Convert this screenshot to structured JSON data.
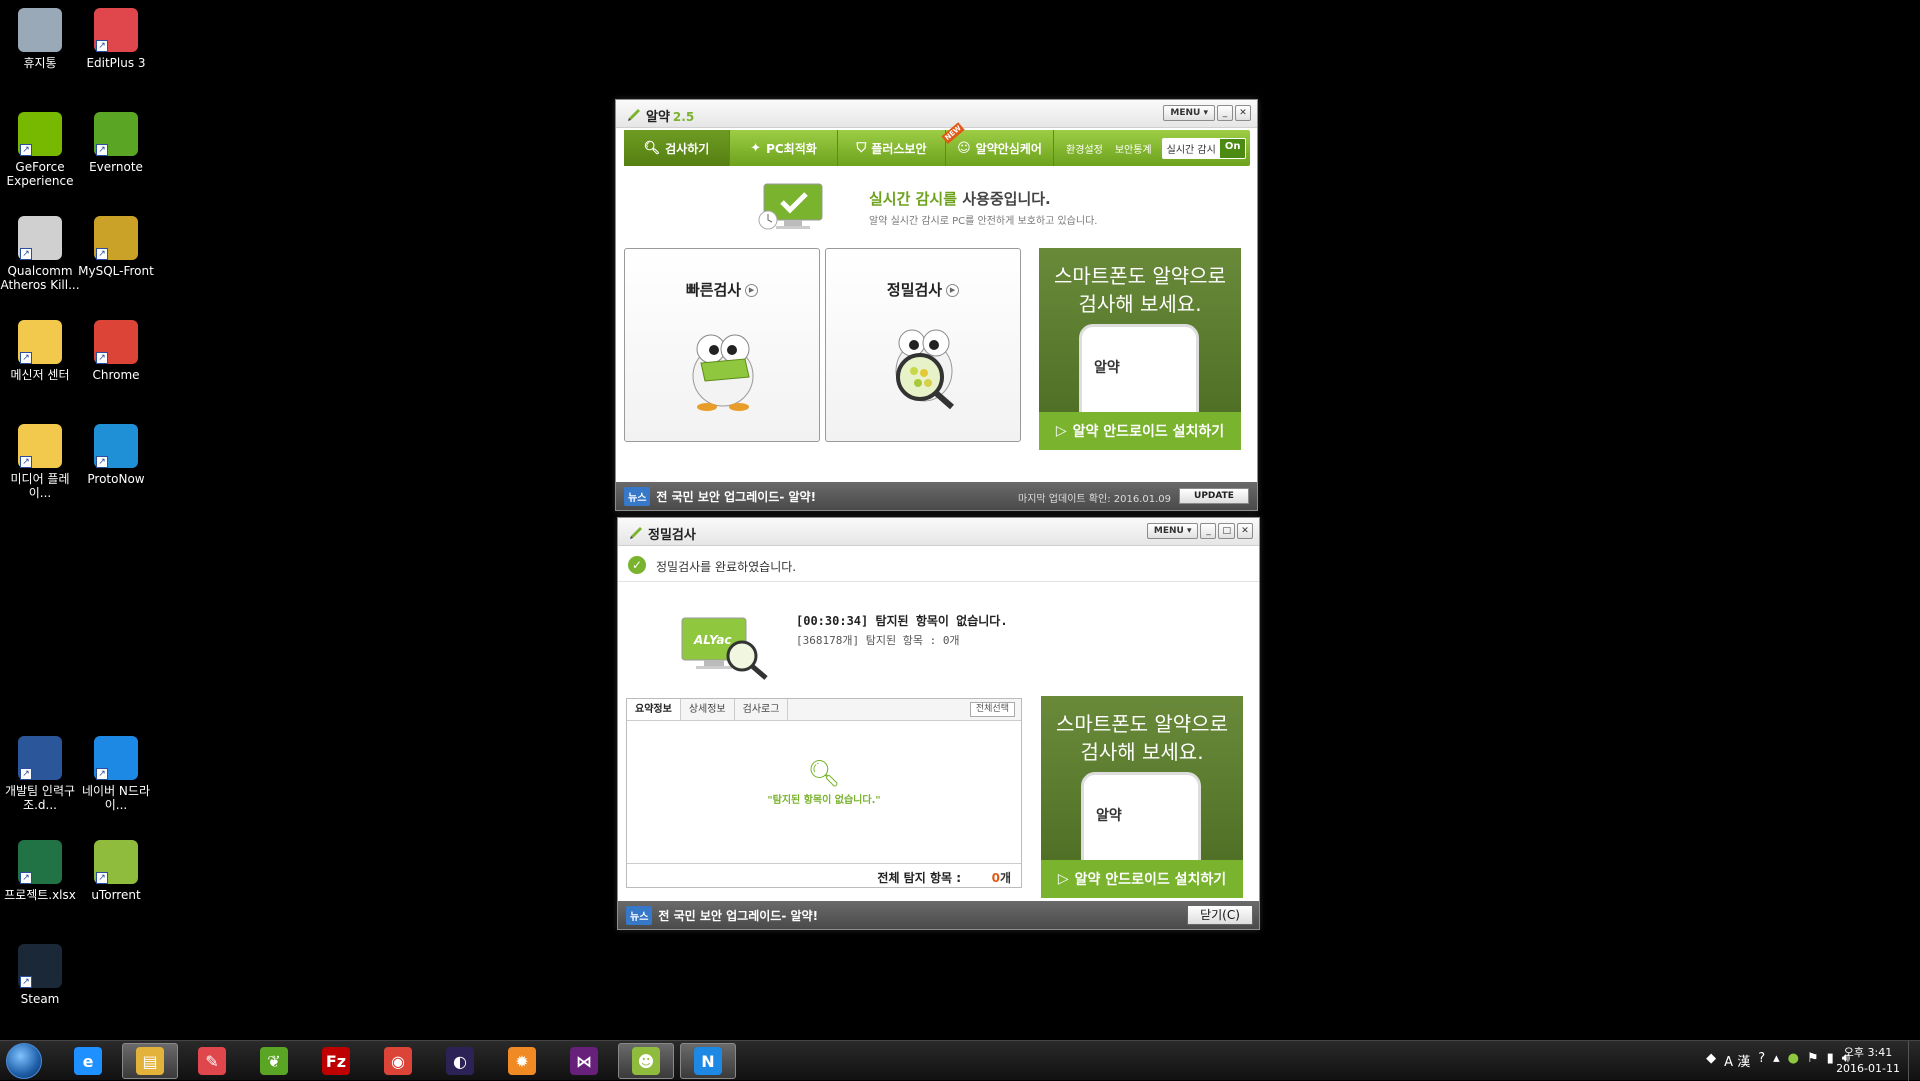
{
  "desktop_icons": [
    {
      "label": "휴지통",
      "icon": "recycle-bin-icon",
      "color": "#9aa9b8"
    },
    {
      "label": "EditPlus 3",
      "icon": "editplus-icon",
      "color": "#e0474c"
    },
    {
      "label": "GeForce Experience",
      "icon": "nvidia-icon",
      "color": "#76b900"
    },
    {
      "label": "Evernote",
      "icon": "evernote-icon",
      "color": "#5ba525"
    },
    {
      "label": "Qualcomm Atheros Kill...",
      "icon": "killer-icon",
      "color": "#d0d0d0"
    },
    {
      "label": "MySQL-Front",
      "icon": "mysql-front-icon",
      "color": "#c9a227"
    },
    {
      "label": "메신저 센터",
      "icon": "messenger-icon",
      "color": "#f2c94c"
    },
    {
      "label": "Chrome",
      "icon": "chrome-icon",
      "color": "#db4437"
    },
    {
      "label": "미디어 플레이...",
      "icon": "media-player-icon",
      "color": "#f2c94c"
    },
    {
      "label": "ProtoNow",
      "icon": "protonow-icon",
      "color": "#1f8fd6"
    },
    {
      "label": "개발팀 인력구조.d...",
      "icon": "word-doc-icon",
      "color": "#2b579a"
    },
    {
      "label": "네이버 N드라이...",
      "icon": "naver-ndrive-icon",
      "color": "#1e88e5"
    },
    {
      "label": "프로젝트.xlsx",
      "icon": "excel-icon",
      "color": "#217346"
    },
    {
      "label": "uTorrent",
      "icon": "utorrent-icon",
      "color": "#8fbc3c"
    },
    {
      "label": "Steam",
      "icon": "steam-icon",
      "color": "#1b2838"
    }
  ],
  "main_window": {
    "title": "알약",
    "version": "2.5",
    "menu_label": "MENU ▾",
    "min_label": "_",
    "close_label": "✕",
    "nav_tabs": [
      {
        "label": "검사하기",
        "icon": "search-icon"
      },
      {
        "label": "PC최적화",
        "icon": "wand-icon"
      },
      {
        "label": "플러스보안",
        "icon": "shield-icon"
      },
      {
        "label": "알약안심케어",
        "icon": "care-icon",
        "badge": "NEW"
      }
    ],
    "settings_label": "환경설정",
    "stats_label": "보안통계",
    "realtime_label": "실시간 감시",
    "realtime_state": "On",
    "status_title_green": "실시간 감시를 ",
    "status_title_dark": "사용중입니다.",
    "status_sub": "알약 실시간 감시로 PC를 안전하게 보호하고 있습니다.",
    "quick_scan": "빠른검사",
    "deep_scan": "정밀검사",
    "ad_text_1": "스마트폰도 알약으로",
    "ad_text_2": "검사해 보세요.",
    "ad_phone_logo": "알약",
    "ad_button": "알약 안드로이드 설치하기",
    "news_tag": "뉴스",
    "news_text": "전 국민 보안 업그레이드- 알약!",
    "last_update_label": "마지막 업데이트 확인: 2016.01.09",
    "update_button": "UPDATE"
  },
  "scan_window": {
    "title": "정밀검사",
    "menu_label": "MENU ▾",
    "min_label": "_",
    "max_label": "□",
    "close_label": "✕",
    "done_text": "정밀검사를 완료하였습니다.",
    "monitor_label": "ALYac",
    "result_line1": "[00:30:34] 탐지된 항목이 없습니다.",
    "result_line2": "[368178개] 탐지된 항목 : 0개",
    "tabs": [
      "요약정보",
      "상세정보",
      "검사로그"
    ],
    "select_all": "전체선택",
    "empty_text": "\"탐지된 항목이 없습니다.\"",
    "total_label": "전체 탐지 항목 :",
    "total_count": "0",
    "total_unit": "개",
    "ad_text_1": "스마트폰도 알약으로",
    "ad_text_2": "검사해 보세요.",
    "ad_phone_logo": "알약",
    "ad_button": "알약 안드로이드 설치하기",
    "news_tag": "뉴스",
    "news_text": "전 국민 보안 업그레이드- 알약!",
    "close_button": "닫기(C)"
  },
  "taskbar": {
    "apps": [
      {
        "name": "ie-icon",
        "glyph": "e",
        "color": "#1e90ff"
      },
      {
        "name": "explorer-icon",
        "glyph": "▤",
        "color": "#e2b23a"
      },
      {
        "name": "editplus-icon",
        "glyph": "✎",
        "color": "#e0474c"
      },
      {
        "name": "evernote-icon",
        "glyph": "❦",
        "color": "#5ba525"
      },
      {
        "name": "filezilla-icon",
        "glyph": "Fz",
        "color": "#bf0000"
      },
      {
        "name": "chrome-icon",
        "glyph": "◉",
        "color": "#db4437"
      },
      {
        "name": "eclipse-icon",
        "glyph": "◐",
        "color": "#2c2255"
      },
      {
        "name": "settings-icon",
        "glyph": "✹",
        "color": "#f08a24"
      },
      {
        "name": "visual-studio-icon",
        "glyph": "⋈",
        "color": "#68217a"
      },
      {
        "name": "alyac-icon",
        "glyph": "☻",
        "color": "#8fbc3c"
      },
      {
        "name": "naver-ndrive-icon",
        "glyph": "N",
        "color": "#1e88e5"
      }
    ],
    "tray_ime": "A 漢",
    "clock_time": "오후 3:41",
    "clock_date": "2016-01-11"
  }
}
